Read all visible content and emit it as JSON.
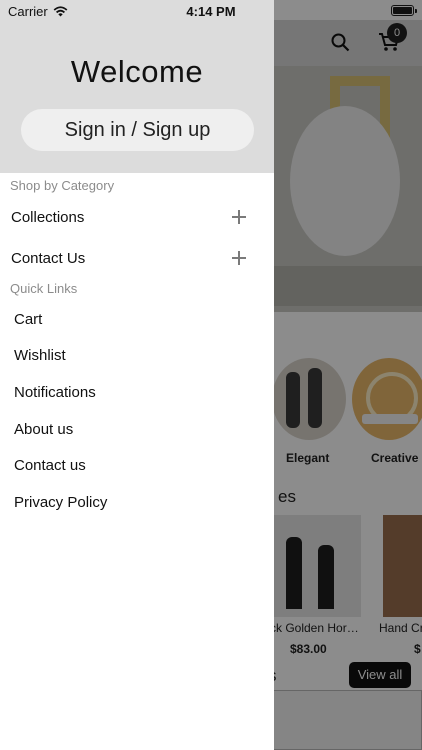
{
  "status_bar": {
    "carrier": "Carrier",
    "time": "4:14 PM"
  },
  "background": {
    "cart_badge": "0",
    "categories": [
      {
        "label": "Elegant"
      },
      {
        "label": "Creative"
      }
    ],
    "section_title_1": "es",
    "products": [
      {
        "name": "ck Golden Hor…",
        "price": "$83.00"
      },
      {
        "name": "Hand Cr",
        "price": "$"
      }
    ],
    "section_title_2": "s",
    "view_all_label": "View all"
  },
  "drawer": {
    "welcome": "Welcome",
    "signin_label": "Sign in / Sign up",
    "shop_by_category": "Shop by Category",
    "categories": [
      {
        "label": "Collections"
      },
      {
        "label": "Contact Us"
      }
    ],
    "quick_links_title": "Quick Links",
    "quick_links": [
      {
        "label": "Cart"
      },
      {
        "label": "Wishlist"
      },
      {
        "label": "Notifications"
      },
      {
        "label": "About us"
      },
      {
        "label": "Contact us"
      },
      {
        "label": "Privacy Policy"
      }
    ]
  }
}
